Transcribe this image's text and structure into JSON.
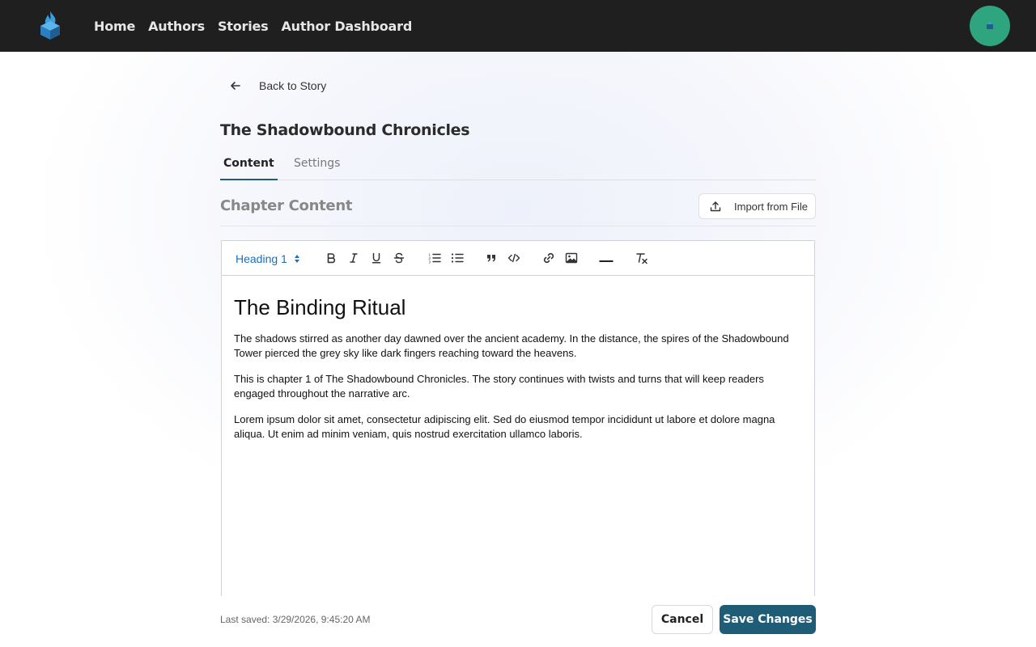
{
  "nav": {
    "items": [
      {
        "label": "Home"
      },
      {
        "label": "Authors"
      },
      {
        "label": "Stories"
      },
      {
        "label": "Author Dashboard"
      }
    ]
  },
  "back_label": "Back to Story",
  "story_title": "The Shadowbound Chronicles",
  "tabs": [
    {
      "label": "Content",
      "active": true
    },
    {
      "label": "Settings",
      "active": false
    }
  ],
  "section": {
    "title": "Chapter Content",
    "import_label": "Import from File"
  },
  "toolbar": {
    "heading_value": "Heading 1",
    "buttons": [
      "bold-icon",
      "italic-icon",
      "underline-icon",
      "strikethrough-icon",
      "ordered-list-icon",
      "bullet-list-icon",
      "quote-icon",
      "code-icon",
      "link-icon",
      "image-icon",
      "horizontal-rule-icon",
      "clear-format-icon"
    ]
  },
  "editor": {
    "heading": "The Binding Ritual",
    "paragraphs": [
      "The shadows stirred as another day dawned over the ancient academy. In the distance, the spires of the Shadowbound Tower pierced the grey sky like dark fingers reaching toward the heavens.",
      "This is chapter 1 of The Shadowbound Chronicles. The story continues with twists and turns that will keep readers engaged throughout the narrative arc.",
      "Lorem ipsum dolor sit amet, consectetur adipiscing elit. Sed do eiusmod tempor incididunt ut labore et dolore magna aliqua. Ut enim ad minim veniam, quis nostrud exercitation ullamco laboris."
    ]
  },
  "footer": {
    "last_saved": "Last saved: 3/29/2026, 9:45:20 AM",
    "cancel_label": "Cancel",
    "save_label": "Save Changes"
  },
  "colors": {
    "topbar": "#1f1f1f",
    "accent": "#1f5c75",
    "avatar": "#2fa57f",
    "heading_select": "#1d6fb8"
  }
}
